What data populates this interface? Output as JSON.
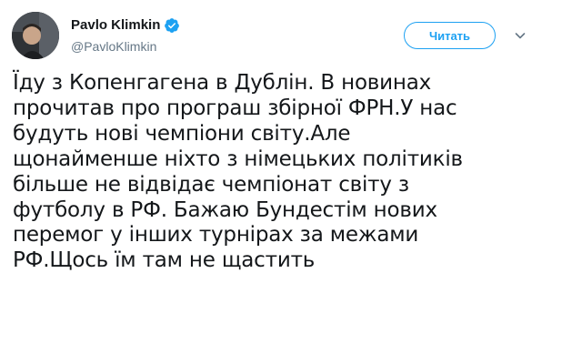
{
  "tweet": {
    "author": {
      "display_name": "Pavlo Klimkin",
      "handle": "@PavloKlimkin",
      "verified": true,
      "avatar_icon": "profile-photo"
    },
    "follow_button": {
      "label": "Читать"
    },
    "menu_icon": "chevron-down-icon",
    "text_lines": [
      "Їду з Копенгагена в Дублін. В новинах",
      "прочитав про програш збірної ФРН.У нас",
      "будуть нові чемпіони світу.Але",
      "щонайменше ніхто з німецьких політиків",
      "більше не відвідає чемпіонат світу з",
      "футболу в РФ. Бажаю Бундестім нових",
      "перемог у інших турнірах за межами",
      "РФ.Щось їм там не щастить"
    ]
  },
  "colors": {
    "accent": "#1da1f2",
    "text": "#14171a",
    "secondary_text": "#657786"
  }
}
